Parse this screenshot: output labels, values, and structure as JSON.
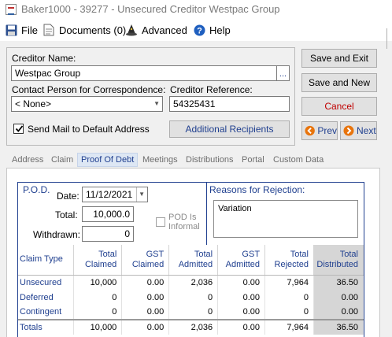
{
  "window": {
    "title": "Baker1000 - 39277 - Unsecured Creditor Westpac Group"
  },
  "menu": {
    "file": "File",
    "documents": "Documents (0)",
    "advanced": "Advanced",
    "help": "Help"
  },
  "creditor": {
    "name_label": "Creditor Name:",
    "name_value": "Westpac Group",
    "ellipsis": "...",
    "contact_label": "Contact Person for Correspondence:",
    "contact_value": "< None>",
    "reference_label": "Creditor Reference:",
    "reference_value": "54325431",
    "send_mail_label": "Send Mail to Default Address",
    "send_mail_checked": true,
    "additional_recipients": "Additional Recipients"
  },
  "actions": {
    "save_exit": "Save and Exit",
    "save_new": "Save and New",
    "cancel": "Cancel",
    "prev": "Prev",
    "next": "Next"
  },
  "tabs": [
    "Address",
    "Claim",
    "Proof Of Debt",
    "Meetings",
    "Distributions",
    "Portal",
    "Custom Data"
  ],
  "active_tab": "Proof Of Debt",
  "pod": {
    "title": "P.O.D.",
    "date_label": "Date:",
    "date_value": "11/12/2021",
    "total_label": "Total:",
    "total_value": "10,000.0",
    "withdrawn_label": "Withdrawn:",
    "withdrawn_value": "0",
    "informal_label": "POD Is Informal",
    "informal_checked": false,
    "reasons_label": "Reasons for Rejection:",
    "reasons_value": "Variation"
  },
  "grid": {
    "columns": [
      "Claim Type",
      "Total Claimed",
      "GST Claimed",
      "Total Admitted",
      "GST Admitted",
      "Total Rejected",
      "Total Distributed"
    ],
    "rows": [
      [
        "Unsecured",
        "10,000",
        "0.00",
        "2,036",
        "0.00",
        "7,964",
        "36.50"
      ],
      [
        "Deferred",
        "0",
        "0.00",
        "0",
        "0.00",
        "0",
        "0.00"
      ],
      [
        "Contingent",
        "0",
        "0.00",
        "0",
        "0.00",
        "0",
        "0.00"
      ]
    ],
    "totals": [
      "Totals",
      "10,000",
      "0.00",
      "2,036",
      "0.00",
      "7,964",
      "36.50"
    ]
  },
  "colors": {
    "accent": "#1f3f8f",
    "cancel": "#c00000",
    "nav": "#e8740c"
  }
}
